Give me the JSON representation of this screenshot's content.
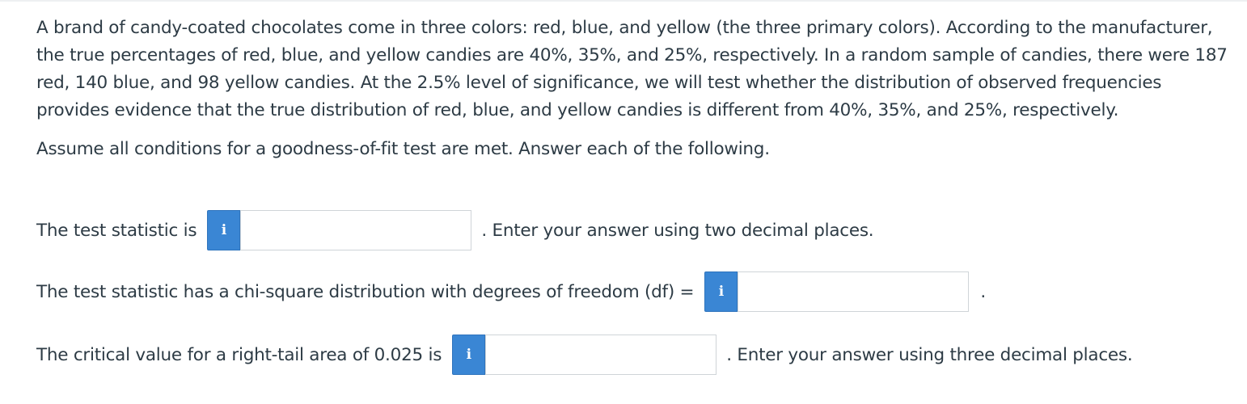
{
  "question": {
    "stem": "A brand of candy-coated chocolates come in three colors: red, blue, and yellow (the three primary colors). According to the manufacturer, the true percentages of red, blue, and yellow candies are 40%, 35%, and 25%, respectively. In a random sample of candies, there were 187 red, 140 blue, and 98 yellow candies. At the 2.5% level of significance, we will test whether the distribution of observed frequencies provides evidence that the true distribution of red, blue, and yellow candies is different from 40%, 35%, and 25%, respectively.",
    "assume": "Assume all conditions for a goodness-of-fit test are met. Answer each of the following."
  },
  "rows": [
    {
      "label": "The test statistic is",
      "info_icon": "i",
      "value": "",
      "after": ". Enter your answer using two decimal places."
    },
    {
      "label": "The test statistic has a chi-square distribution with degrees of freedom (df) =",
      "info_icon": "i",
      "value": "",
      "after": "."
    },
    {
      "label": "The critical value for a right-tail area of 0.025 is",
      "info_icon": "i",
      "value": "",
      "after": ". Enter your answer using three decimal places."
    }
  ],
  "colors": {
    "info_button": "#3a86d4",
    "text": "#2d3b45",
    "input_border": "#cfd4d8"
  }
}
